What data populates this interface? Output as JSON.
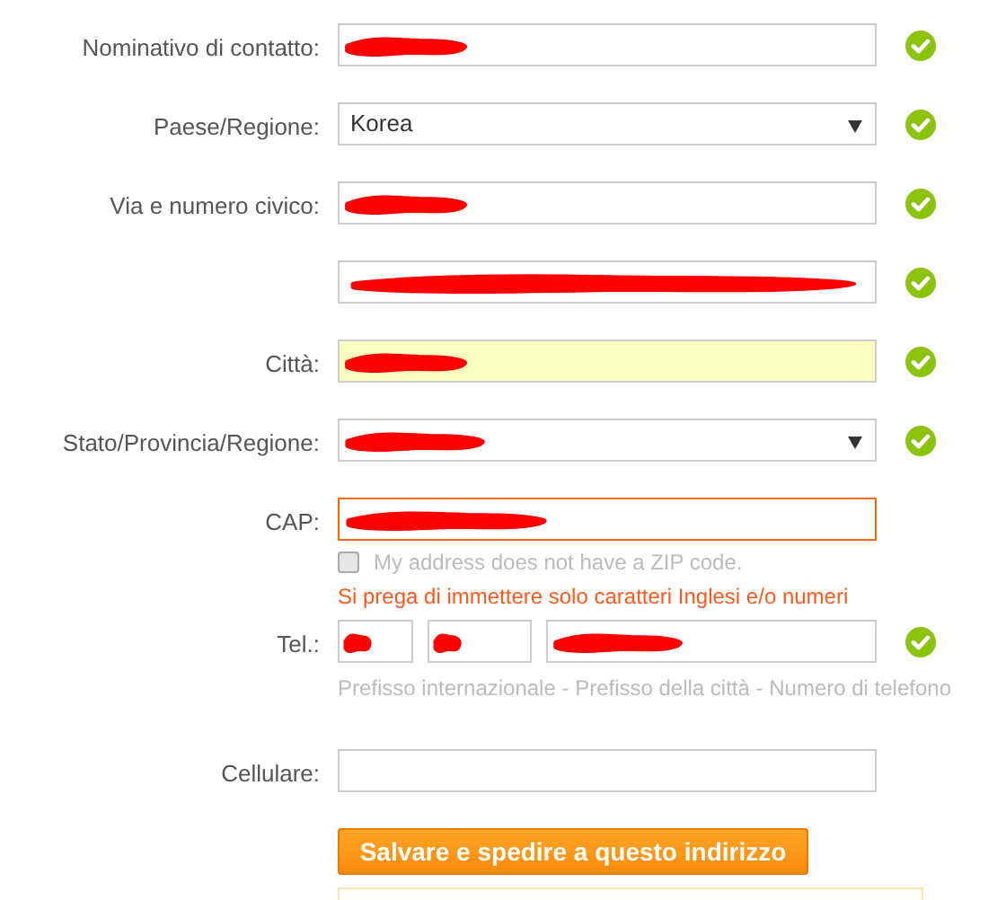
{
  "fields": [
    {
      "label": "Nominativo di contatto:",
      "kind": "text",
      "redacted": true,
      "valid": true
    },
    {
      "label": "Paese/Regione:",
      "kind": "select",
      "value": "Korea",
      "redacted": false,
      "valid": true
    },
    {
      "label": "Via e numero civico:",
      "kind": "text",
      "redacted": true,
      "valid": true
    },
    {
      "kind": "text",
      "redacted": true,
      "valid": true
    },
    {
      "label": "Città:",
      "kind": "text",
      "redacted": true,
      "valid": true,
      "highlighted": true
    },
    {
      "label": "Stato/Provincia/Regione:",
      "kind": "select",
      "redacted": true,
      "valid": true
    },
    {
      "label": "CAP:",
      "kind": "text",
      "redacted": true,
      "valid": false,
      "error": true,
      "checkbox": {
        "label": "My address does not have a ZIP code.",
        "checked": false
      },
      "message": "Si prega di immettere solo caratteri Inglesi e/o numeri"
    },
    {
      "label": "Tel.:",
      "kind": "phone",
      "valid": true,
      "parts": [
        {
          "redacted": true
        },
        {
          "redacted": true
        },
        {
          "redacted": true
        }
      ],
      "hint": "Prefisso internazionale - Prefisso della città - Numero di telefono"
    },
    {
      "label": "Cellulare:",
      "kind": "text",
      "redacted": false,
      "valid": false
    }
  ],
  "submit": "Salvare e spedire a questo indirizzo"
}
